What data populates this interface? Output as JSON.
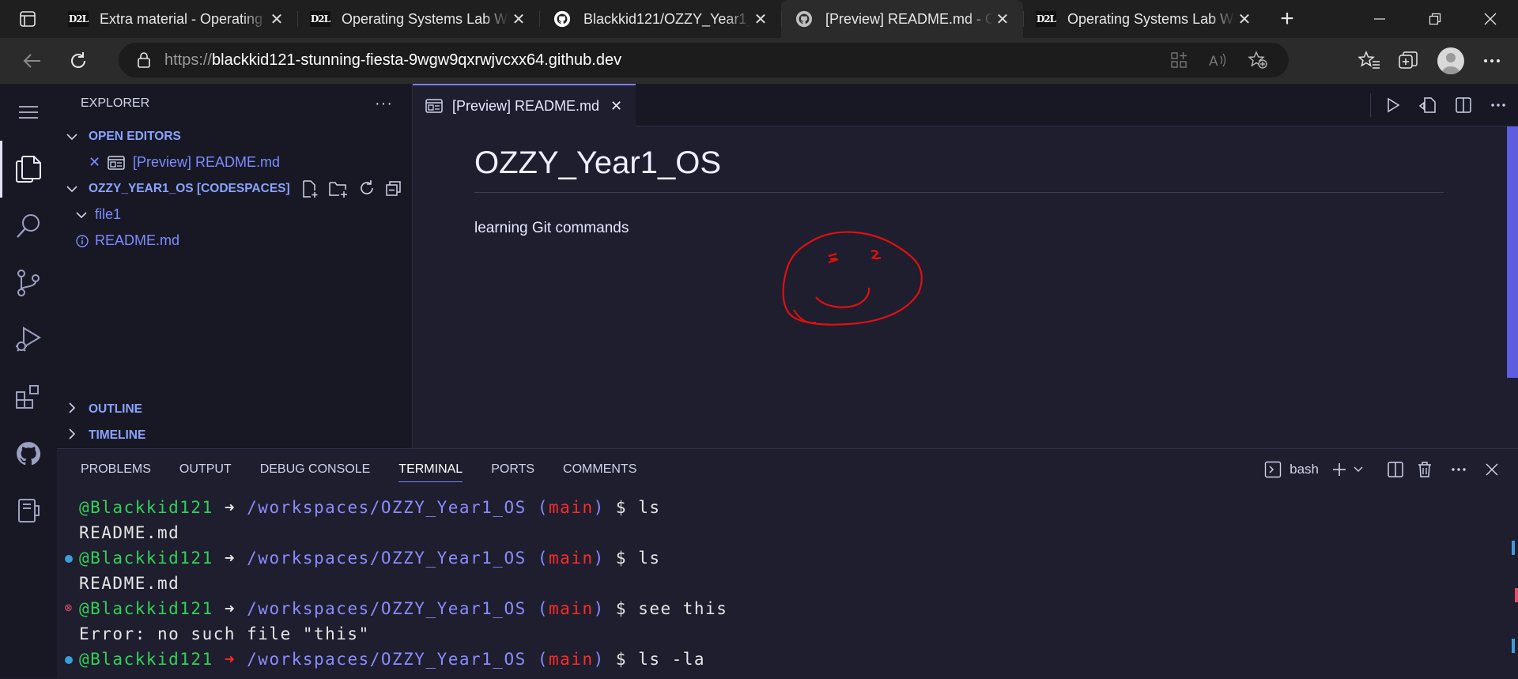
{
  "browser": {
    "tabs": [
      {
        "favicon": "D2L",
        "title": "Extra material - Operating Systems",
        "active": false
      },
      {
        "favicon": "D2L",
        "title": "Operating Systems Lab Week",
        "active": false
      },
      {
        "favicon": "github-icon",
        "title": "Blackkid121/OZZY_Year1_OS",
        "active": false
      },
      {
        "favicon": "github-icon",
        "title": "[Preview] README.md - OZZY",
        "active": true
      },
      {
        "favicon": "D2L",
        "title": "Operating Systems Lab Week",
        "active": false
      }
    ],
    "url_prefix": "https://",
    "url_host": "blackkid121-stunning-fiesta-9wgw9qxrwjvcxx64.github.dev"
  },
  "sidebar": {
    "title": "EXPLORER",
    "open_editors_label": "OPEN EDITORS",
    "open_editor_item": "[Preview] README.md",
    "workspace_label": "OZZY_YEAR1_OS [CODESPACES]",
    "folder": "file1",
    "file": "README.md",
    "outline_label": "OUTLINE",
    "timeline_label": "TIMELINE"
  },
  "editor": {
    "tab_label": "[Preview] README.md",
    "heading": "OZZY_Year1_OS",
    "paragraph": "learning Git commands"
  },
  "panel": {
    "tabs": [
      "PROBLEMS",
      "OUTPUT",
      "DEBUG CONSOLE",
      "TERMINAL",
      "PORTS",
      "COMMENTS"
    ],
    "active_tab": "TERMINAL",
    "shell": "bash"
  },
  "terminal": {
    "user": "@Blackkid121",
    "path": "/workspaces/OZZY_Year1_OS",
    "branch": "main",
    "lines": [
      {
        "cmd": "ls",
        "status": "none",
        "arrow": "white"
      },
      {
        "out": "README.md"
      },
      {
        "cmd": "ls",
        "status": "ok",
        "arrow": "white"
      },
      {
        "out": "README.md"
      },
      {
        "cmd": "see this",
        "status": "error",
        "arrow": "white"
      },
      {
        "out": "Error: no such file \"this\""
      },
      {
        "cmd": "ls -la",
        "status": "ok",
        "arrow": "red"
      }
    ]
  },
  "colors": {
    "accent": "#7c7cff",
    "prompt_user": "#31d158",
    "branch": "#ff2a2a",
    "drawing": "#e01010"
  }
}
